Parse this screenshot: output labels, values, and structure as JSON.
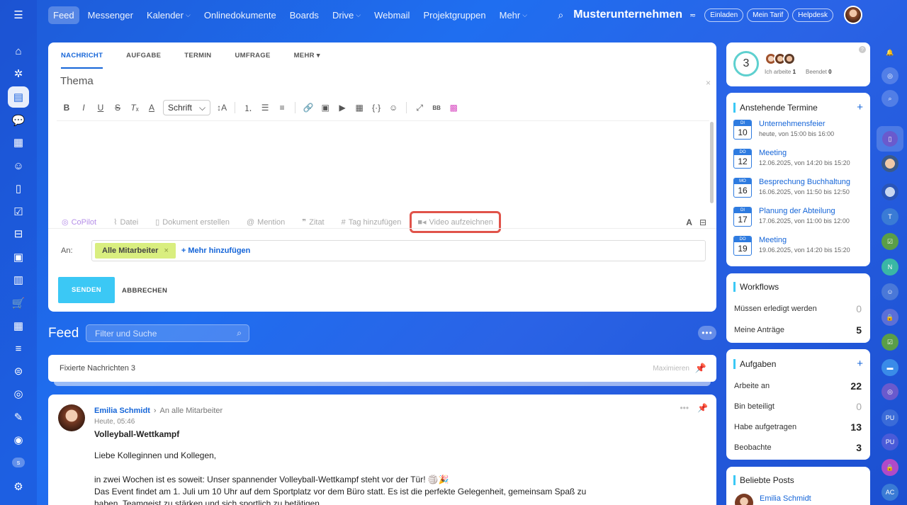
{
  "nav": {
    "items": [
      {
        "label": "Feed",
        "active": true
      },
      {
        "label": "Messenger"
      },
      {
        "label": "Kalender",
        "chev": true
      },
      {
        "label": "Onlinedokumente"
      },
      {
        "label": "Boards"
      },
      {
        "label": "Drive",
        "chev": true
      },
      {
        "label": "Webmail"
      },
      {
        "label": "Projektgruppen"
      },
      {
        "label": "Mehr",
        "chev": true
      }
    ],
    "company": "Musterunternehmen",
    "invite": "Einladen",
    "tariff": "Mein Tarif",
    "helpdesk": "Helpdesk"
  },
  "composer": {
    "tabs": [
      "NACHRICHT",
      "AUFGABE",
      "TERMIN",
      "UMFRAGE",
      "MEHR"
    ],
    "theme_placeholder": "Thema",
    "font_select": "Schrift",
    "attach": {
      "copilot": "CoPilot",
      "file": "Datei",
      "doc": "Dokument erstellen",
      "mention": "Mention",
      "quote": "Zitat",
      "tag": "Tag hinzufügen",
      "video": "Video aufzeichnen"
    },
    "to_label": "An:",
    "recipient": "Alle Mitarbeiter",
    "add_more": "+ Mehr hinzufügen",
    "send": "SENDEN",
    "cancel": "ABBRECHEN"
  },
  "feed": {
    "title": "Feed",
    "search_placeholder": "Filter und Suche",
    "pinned_label": "Fixierte Nachrichten",
    "pinned_count": "3",
    "maximize": "Maximieren"
  },
  "post": {
    "author": "Emilia Schmidt",
    "audience": "An alle Mitarbeiter",
    "time": "Heute, 05:46",
    "title": "Volleyball-Wettkampf",
    "greeting": "Liebe Kolleginnen und Kollegen,",
    "line1": "in zwei Wochen ist es soweit: Unser spannender Volleyball-Wettkampf steht vor der Tür! 🏐🎉",
    "line2": "Das Event findet am 1. Juli um 10 Uhr auf dem Sportplatz vor dem Büro statt. Es ist die perfekte Gelegenheit, gemeinsam Spaß zu",
    "line3": "haben, Teamgeist zu stärken und sich sportlich zu betätigen."
  },
  "status_widget": {
    "count": "3",
    "working_label": "Ich arbeite",
    "working_value": "1",
    "done_label": "Beendet",
    "done_value": "0"
  },
  "events": {
    "title": "Anstehende Termine",
    "items": [
      {
        "dow": "DI",
        "day": "10",
        "title": "Unternehmensfeier",
        "time": "heute, von 15:00 bis 16:00"
      },
      {
        "dow": "DO",
        "day": "12",
        "title": "Meeting",
        "time": "12.06.2025, von 14:20 bis 15:20"
      },
      {
        "dow": "MO",
        "day": "16",
        "title": "Besprechung Buchhaltung",
        "time": "16.06.2025, von 11:50 bis 12:50"
      },
      {
        "dow": "DI",
        "day": "17",
        "title": "Planung der Abteilung",
        "time": "17.06.2025, von 11:00 bis 12:00"
      },
      {
        "dow": "DO",
        "day": "19",
        "title": "Meeting",
        "time": "19.06.2025, von 14:20 bis 15:20"
      }
    ]
  },
  "workflows": {
    "title": "Workflows",
    "rows": [
      {
        "label": "Müssen erledigt werden",
        "value": "0"
      },
      {
        "label": "Meine Anträge",
        "value": "5"
      }
    ]
  },
  "tasks": {
    "title": "Aufgaben",
    "rows": [
      {
        "label": "Arbeite an",
        "value": "22"
      },
      {
        "label": "Bin beteiligt",
        "value": "0"
      },
      {
        "label": "Habe aufgetragen",
        "value": "13"
      },
      {
        "label": "Beobachte",
        "value": "3"
      }
    ]
  },
  "popular": {
    "title": "Beliebte Posts",
    "author": "Emilia Schmidt"
  },
  "left_badge": "s",
  "right_bar": {
    "t_label": "T",
    "n_label": "N",
    "pu1_label": "PU",
    "pu2_label": "PU",
    "ac_label": "AC"
  },
  "colors": {
    "accent": "#1565d8",
    "send": "#3bc8f5",
    "chip": "#d9ee7f",
    "highlight": "#e0534a"
  }
}
